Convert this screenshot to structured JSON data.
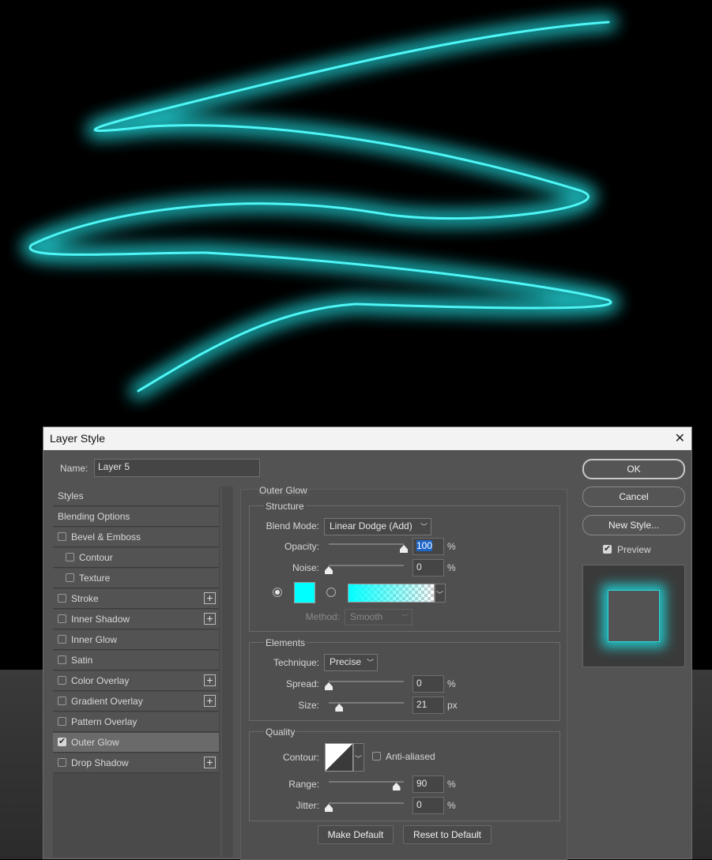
{
  "dialog": {
    "title": "Layer Style",
    "name_label": "Name:",
    "name_value": "Layer 5"
  },
  "styles_list": [
    {
      "label": "Styles",
      "checkbox": false,
      "checked": false,
      "plus": false,
      "indent": false
    },
    {
      "label": "Blending Options",
      "checkbox": false,
      "checked": false,
      "plus": false,
      "indent": false
    },
    {
      "label": "Bevel & Emboss",
      "checkbox": true,
      "checked": false,
      "plus": false,
      "indent": false
    },
    {
      "label": "Contour",
      "checkbox": true,
      "checked": false,
      "plus": false,
      "indent": true
    },
    {
      "label": "Texture",
      "checkbox": true,
      "checked": false,
      "plus": false,
      "indent": true
    },
    {
      "label": "Stroke",
      "checkbox": true,
      "checked": false,
      "plus": true,
      "indent": false
    },
    {
      "label": "Inner Shadow",
      "checkbox": true,
      "checked": false,
      "plus": true,
      "indent": false
    },
    {
      "label": "Inner Glow",
      "checkbox": true,
      "checked": false,
      "plus": false,
      "indent": false
    },
    {
      "label": "Satin",
      "checkbox": true,
      "checked": false,
      "plus": false,
      "indent": false
    },
    {
      "label": "Color Overlay",
      "checkbox": true,
      "checked": false,
      "plus": true,
      "indent": false
    },
    {
      "label": "Gradient Overlay",
      "checkbox": true,
      "checked": false,
      "plus": true,
      "indent": false
    },
    {
      "label": "Pattern Overlay",
      "checkbox": true,
      "checked": false,
      "plus": false,
      "indent": false
    },
    {
      "label": "Outer Glow",
      "checkbox": true,
      "checked": true,
      "plus": false,
      "indent": false,
      "active": true
    },
    {
      "label": "Drop Shadow",
      "checkbox": true,
      "checked": false,
      "plus": true,
      "indent": false
    }
  ],
  "outer_glow": {
    "title": "Outer Glow",
    "structure": {
      "title": "Structure",
      "blend_mode_label": "Blend Mode:",
      "blend_mode_value": "Linear Dodge (Add)",
      "opacity_label": "Opacity:",
      "opacity_value": "100",
      "opacity_level": 1.0,
      "noise_label": "Noise:",
      "noise_value": "0",
      "noise_level": 0.0,
      "percent": "%",
      "glow_color": "#00ffff",
      "method_label": "Method:",
      "method_value": "Smooth"
    },
    "elements": {
      "title": "Elements",
      "technique_label": "Technique:",
      "technique_value": "Precise",
      "spread_label": "Spread:",
      "spread_value": "0",
      "spread_level": 0.0,
      "size_label": "Size:",
      "size_value": "21",
      "size_level": 0.14,
      "percent": "%",
      "px": "px"
    },
    "quality": {
      "title": "Quality",
      "contour_label": "Contour:",
      "anti_aliased_label": "Anti-aliased",
      "range_label": "Range:",
      "range_value": "90",
      "range_level": 0.9,
      "jitter_label": "Jitter:",
      "jitter_value": "0",
      "jitter_level": 0.0,
      "percent": "%"
    },
    "make_default": "Make Default",
    "reset_default": "Reset to Default"
  },
  "buttons": {
    "ok": "OK",
    "cancel": "Cancel",
    "new_style": "New Style...",
    "preview_label": "Preview",
    "preview_checked": true
  },
  "colors": {
    "glow": "#1ee3e6",
    "dialog_bg": "#535353"
  }
}
